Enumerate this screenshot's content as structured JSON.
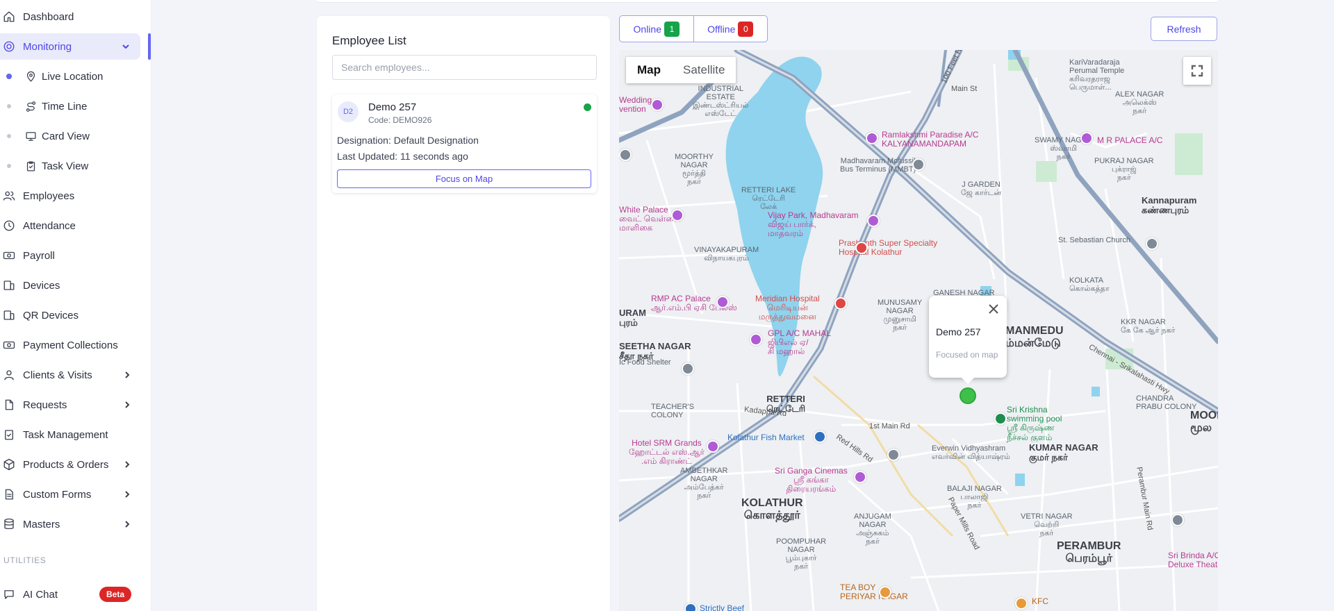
{
  "sidebar": {
    "items": [
      {
        "label": "Dashboard",
        "icon": "home-icon"
      },
      {
        "label": "Monitoring",
        "icon": "monitoring-icon"
      },
      {
        "label": "Employees",
        "icon": "users-icon"
      },
      {
        "label": "Attendance",
        "icon": "clock-icon"
      },
      {
        "label": "Payroll",
        "icon": "banknote-icon"
      },
      {
        "label": "Devices",
        "icon": "devices-icon"
      },
      {
        "label": "QR Devices",
        "icon": "qr-devices-icon"
      },
      {
        "label": "Payment Collections",
        "icon": "payment-icon"
      },
      {
        "label": "Clients & Visits",
        "icon": "user-icon"
      },
      {
        "label": "Requests",
        "icon": "file-icon"
      },
      {
        "label": "Task Management",
        "icon": "clipboard-check-icon"
      },
      {
        "label": "Products & Orders",
        "icon": "package-icon"
      },
      {
        "label": "Custom Forms",
        "icon": "form-icon"
      },
      {
        "label": "Masters",
        "icon": "database-icon"
      },
      {
        "label": "AI Chat",
        "icon": "chat-icon"
      }
    ],
    "sub_items": [
      {
        "label": "Live Location",
        "icon": "map-pin-icon"
      },
      {
        "label": "Time Line",
        "icon": "route-icon"
      },
      {
        "label": "Card View",
        "icon": "monitor-icon"
      },
      {
        "label": "Task View",
        "icon": "task-icon"
      }
    ],
    "section_utilities": "UTILITIES",
    "ai_badge": "Beta"
  },
  "employee_panel": {
    "title": "Employee List",
    "search_placeholder": "Search employees...",
    "card": {
      "initials": "D2",
      "name": "Demo 257",
      "code": "Code: DEMO926",
      "designation": "Designation: Default Designation",
      "last_updated": "Last Updated: 11 seconds ago",
      "focus_label": "Focus on Map",
      "status_color": "#16a34a"
    }
  },
  "toolbar": {
    "online_label": "Online",
    "online_count": "1",
    "offline_label": "Offline",
    "offline_count": "0",
    "refresh_label": "Refresh"
  },
  "map": {
    "tab_map": "Map",
    "tab_satellite": "Satellite",
    "popup_name": "Demo 257",
    "popup_sub": "Focused on map",
    "labels": {
      "l1": "KariVaradaraja\nPerumal Temple\nகரிவரதராஜ\nபெருமாள்...",
      "l2": "Main St",
      "l3": "100 Feet Rd",
      "l4": "INDUSTRIAL\nESTATE\nஇண்டஸ்ட்ரியல்\nஎஸ்டேட்",
      "l5": "Wedding\nvention",
      "l6": "Ramlakshmi Paradise A/C\nKALYANAMANDAPAM",
      "l7": "M R PALACE A/C",
      "l8": "MOORTHY\nNAGAR\nமூர்த்தி\nநகர்",
      "l9": "Madhavaram Mofussil\nBus Terminus (MMBT)",
      "l10": "RETTERI LAKE\nரெட்டேரி\nலேக்",
      "l11": "White Palace\nவைட் வெள்ளை\nமாளிகை",
      "l12": "Vijay Park, Madhavaram\nவிஜய் பார்க்,\nமாதவரம்",
      "l13": "Prashanth Super Specialty\nHospital Kolathur",
      "l14": "Kannapuram\nகண்ணபுரம்",
      "l15": "St. Sebastian Church",
      "l16": "VINAYAKAPURAM\nவிநாயகபுரம்",
      "l17": "RMP AC Palace\nஆர்.எம்.பி ஏசி பேலஸ்",
      "l18": "Meridian Hospital\nமெரிடியன்\nமருத்துவமனை",
      "l19": "GPL A/C MAHAL\nஜிபிஎல் ஏ/\nசி மஹால்",
      "l20": "MANMEDU\nம்மன்மேடு",
      "l21": "RETTERI\nரெட்டேரி",
      "l22": "Sri Krishna\nswimming pool\nஸ்ரீ கிருஷ்ண\nநீச்சல் குளம்",
      "l23": "Hotel SRM Grands\nஹோட்டல் எஸ்.ஆர்\n.எம் கிராண்ட்",
      "l24": "Kolathur Fish Market",
      "l25": "Everwin Vidhyashram\nஎவர்வின் வித்யாஷ்ரம்",
      "l26": "KUMAR NAGAR\nகுமர் நகர்",
      "l27": "AMBETHKAR\nNAGAR\nஅம்பேத்கர்\nநகர்",
      "l28": "Sri Ganga Cinemas\nஸ்ரீ கங்கா\nதிரையரங்கம்",
      "l29": "KOLATHUR\nகொளத்தூர்",
      "l30": "PERAMBUR\nபெரம்பூர்",
      "l31": "TEA BOY\nPERIYAR NAGAR",
      "l32": "KFC",
      "l33": "Red Hills Rd",
      "l34": "Kadappa Rd",
      "l35": "Paper Mills Road",
      "l36": "Chennai - Srikalahasti Hwy",
      "l37": "GANESH NAGAR",
      "l38": "MUNUSAMY\nNAGAR\nமுனுசாமி\nநகர்",
      "l39": "SEETHA NAGAR\nசீதா நகர்",
      "l40": "TEACHER'S\nCOLONY",
      "l41": "Strictly Beef",
      "l42": "MOOL\nமூல",
      "l43": "Sri Brinda A/C\nDeluxe Theatre",
      "l44": "KOLKATA\nகொல்கத்தா",
      "l45": "KKR NAGAR\nகே கே ஆர் நகர்",
      "l46": "CHANDRA\nPRABU COLONY",
      "l47": "URAM\nபுரம்",
      "l48": "ANJUGAM\nNAGAR\nஅஞ்சுகம்\nநகர்",
      "l49": "POOMPUHAR\nNAGAR\nபூம்புகார்\nநகர்",
      "l50": "BALAJI NAGAR\nபாலாஜி\nநகர்",
      "l51": "VETRI NAGAR\nவெற்றி\nநகர்",
      "l52": "SWAMY NAGAR\nஸ்வாமி\nநகர்",
      "l53": "ALEX NAGAR\nஅலெக்ஸ்\nநகர்",
      "l54": "PUKRAJ NAGAR\nபுக்ராஜ்\nநகர்",
      "l55": "J GARDEN\nஜே கார்டன்",
      "l56": "1st Main Rd",
      "l57": "Perambur Main Rd",
      "l58": "Ic Food Shelter"
    }
  },
  "colors": {
    "accent": "#4f46e5",
    "online": "#16a34a",
    "offline": "#dc2626",
    "water": "#8fd3ee",
    "major_road": "#8fa3bf",
    "marker": "#3ec04a"
  }
}
